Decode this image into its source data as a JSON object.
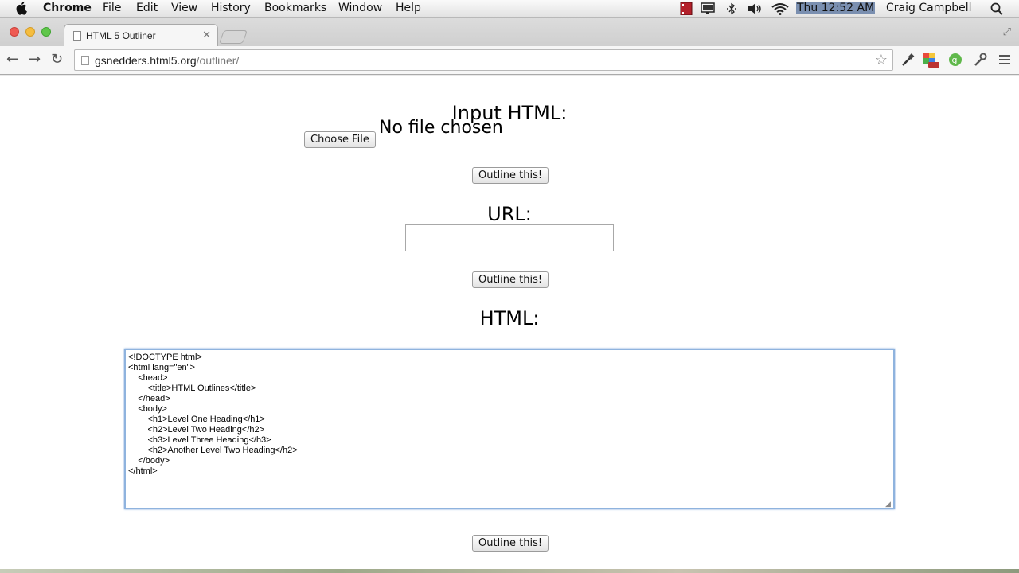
{
  "menubar": {
    "app_name": "Chrome",
    "items": [
      "File",
      "Edit",
      "View",
      "History",
      "Bookmarks",
      "Window",
      "Help"
    ],
    "clock": "Thu 12:52 AM",
    "user": "Craig Campbell"
  },
  "tab": {
    "title": "HTML 5 Outliner"
  },
  "omnibox": {
    "domain": "gsnedders.html5.org",
    "path": "/outliner/"
  },
  "page": {
    "input_html_heading": "Input HTML:",
    "choose_file_label": "Choose File",
    "no_file_text": "No file chosen",
    "outline_button_1": "Outline this!",
    "url_heading": "URL:",
    "url_value": "",
    "outline_button_2": "Outline this!",
    "html_heading": "HTML:",
    "html_content": "<!DOCTYPE html>\n<html lang=\"en\">\n\t<head>\n\t\t<title>HTML Outlines</title>\n\t</head>\n\t<body>\n\t\t<h1>Level One Heading</h1>\n\t\t<h2>Level Two Heading</h2>\n\t\t<h3>Level Three Heading</h3>\n\t\t<h2>Another Level Two Heading</h2>\n\t</body>\n</html>",
    "outline_button_3": "Outline this!"
  },
  "colors": {
    "textarea_focus": "#8fb3de",
    "traffic_red": "#ee5a52",
    "traffic_yellow": "#f5bd3f",
    "traffic_green": "#5fc64a"
  }
}
